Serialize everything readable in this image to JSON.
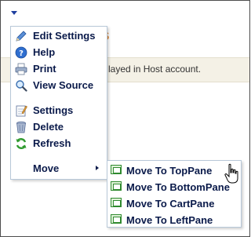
{
  "background": {
    "title_fragment": "s",
    "notice_text": "layed in Host account."
  },
  "menu": {
    "items": [
      {
        "label": "Edit Settings",
        "icon": "pencil-icon"
      },
      {
        "label": "Help",
        "icon": "help-icon"
      },
      {
        "label": "Print",
        "icon": "printer-icon"
      },
      {
        "label": "View Source",
        "icon": "magnifier-icon"
      },
      {
        "label": "Settings",
        "icon": "settings-icon"
      },
      {
        "label": "Delete",
        "icon": "trash-icon"
      },
      {
        "label": "Refresh",
        "icon": "refresh-icon"
      },
      {
        "label": "Move",
        "icon": "chevron-right-icon"
      }
    ]
  },
  "submenu": {
    "items": [
      {
        "label": "Move To TopPane",
        "icon": "pane-icon"
      },
      {
        "label": "Move To BottomPane",
        "icon": "pane-icon"
      },
      {
        "label": "Move To CartPane",
        "icon": "pane-icon"
      },
      {
        "label": "Move To LeftPane",
        "icon": "pane-icon"
      }
    ]
  },
  "colors": {
    "menu_text": "#0a1a4a",
    "menu_border": "#b8c8d8",
    "title_accent": "#e08a3c",
    "pane_green": "#2f8a2f"
  }
}
